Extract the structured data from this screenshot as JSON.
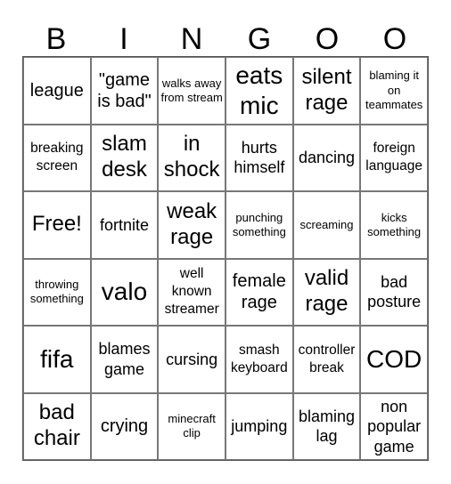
{
  "title_letters": [
    "B",
    "I",
    "N",
    "G",
    "O",
    "O"
  ],
  "cells": [
    [
      "league",
      "\"game is bad\"",
      "walks away from stream",
      "eats mic",
      "silent rage",
      "blaming it on teammates"
    ],
    [
      "breaking screen",
      "slam desk",
      "in shock",
      "hurts himself",
      "dancing",
      "foreign language"
    ],
    [
      "Free!",
      "fortnite",
      "weak rage",
      "punching something",
      "screaming",
      "kicks something"
    ],
    [
      "throwing something",
      "valo",
      "well known streamer",
      "female rage",
      "valid rage",
      "bad posture"
    ],
    [
      "fifa",
      "blames game",
      "cursing",
      "smash keyboard",
      "controller break",
      "COD"
    ],
    [
      "bad chair",
      "crying",
      "minecraft clip",
      "jumping",
      "blaming lag",
      "non popular game"
    ]
  ]
}
